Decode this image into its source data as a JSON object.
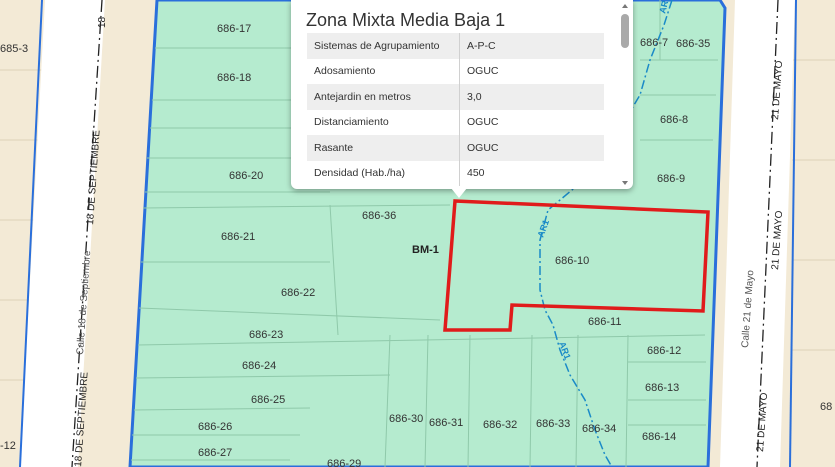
{
  "popup": {
    "title": "Zona Mixta Media Baja 1",
    "rows": [
      {
        "key": "Sistemas de Agrupamiento",
        "value": "A-P-C"
      },
      {
        "key": "Adosamiento",
        "value": "OGUC"
      },
      {
        "key": "Antejardin en metros",
        "value": "3,0"
      },
      {
        "key": "Distanciamiento",
        "value": "OGUC"
      },
      {
        "key": "Rasante",
        "value": "OGUC"
      },
      {
        "key": "Densidad (Hab./ha)",
        "value": "450"
      }
    ]
  },
  "map": {
    "block_label": "BM-1",
    "zone_tag": "AR1",
    "lots": {
      "l17": "686-17",
      "l18": "686-18",
      "l20": "686-20",
      "l21": "686-21",
      "l22": "686-22",
      "l23": "686-23",
      "l24": "686-24",
      "l25": "686-25",
      "l26": "686-26",
      "l27": "686-27",
      "l29": "686-29",
      "l30": "686-30",
      "l31": "686-31",
      "l32": "686-32",
      "l33": "686-33",
      "l34": "686-34",
      "l36": "686-36",
      "l7": "686-7",
      "l35": "686-35",
      "l8": "686-8",
      "l9": "686-9",
      "l10": "686-10",
      "l11": "686-11",
      "l12": "686-12",
      "l13": "686-13",
      "l14": "686-14",
      "left3": "685-3",
      "left12": "-12",
      "right68": "68"
    },
    "streets": {
      "sept_upper": "18 DE SEPTIEMBRE",
      "sept_lower": "18 DE SEPTIEMBRE",
      "sept_name": "Calle 18 de Septiembre",
      "mayo_top": "21 DE MAYO",
      "mayo_mid": "21 DE MAYO",
      "mayo_low": "21 DE MAYO",
      "mayo_name": "Calle 21 de Mayo"
    },
    "colors": {
      "zone_fill": "#b5ebcf",
      "zone_border": "#2a6fdb",
      "highlight": "#e01b1b",
      "ar_line": "#1a8ac7",
      "background": "#f3ead6"
    }
  }
}
